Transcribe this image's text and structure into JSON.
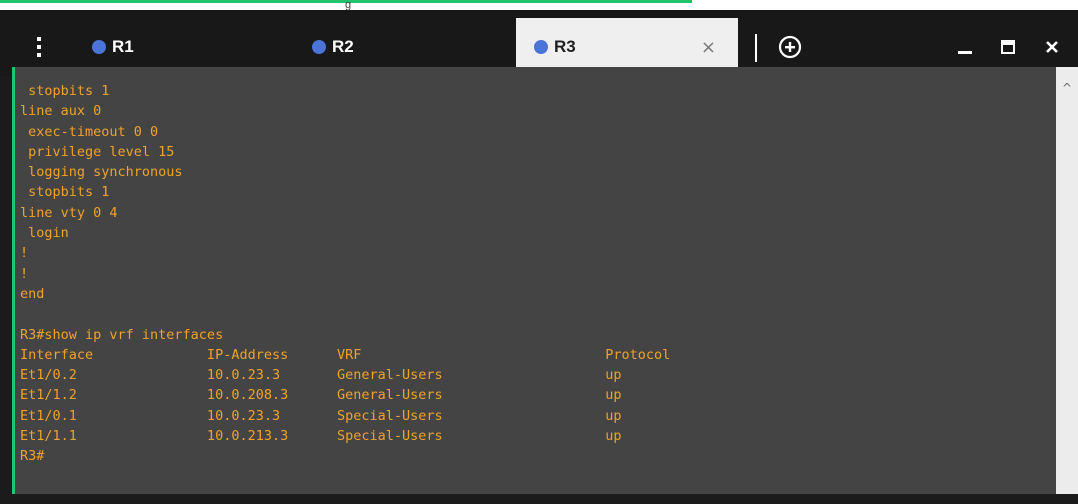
{
  "tabs": [
    {
      "label": "R1",
      "dot_color": "#4a74d8",
      "active": false
    },
    {
      "label": "R2",
      "dot_color": "#4a74d8",
      "active": false
    },
    {
      "label": "R3",
      "dot_color": "#4a74d8",
      "active": true,
      "close": "×"
    }
  ],
  "window_controls": {
    "menu_icon": "vertical-ellipsis",
    "new_tab_icon": "circled-plus",
    "minimize_icon": "minimize",
    "maximize_icon": "maximize",
    "close_icon": "close"
  },
  "colors": {
    "terminal_text": "#f0a22a",
    "terminal_bg": "#444444",
    "tab_dot": "#4a74d8",
    "accent_green": "#21c46b",
    "active_tab_underline": "#4a74d8"
  },
  "background_fragments": {
    "top_text": "g",
    "side_glyph": "(",
    "side_glyph2": ":"
  },
  "terminal": {
    "lines": [
      " stopbits 1",
      "line aux 0",
      " exec-timeout 0 0",
      " privilege level 15",
      " logging synchronous",
      " stopbits 1",
      "line vty 0 4",
      " login",
      "!",
      "!",
      "end",
      "",
      "R3#show ip vrf interfaces",
      "Interface              IP-Address      VRF                              Protocol",
      "Et1/0.2                10.0.23.3       General-Users                    up",
      "Et1/1.2                10.0.208.3      General-Users                    up",
      "Et1/0.1                10.0.23.3       Special-Users                    up",
      "Et1/1.1                10.0.213.3      Special-Users                    up",
      "R3#"
    ]
  }
}
